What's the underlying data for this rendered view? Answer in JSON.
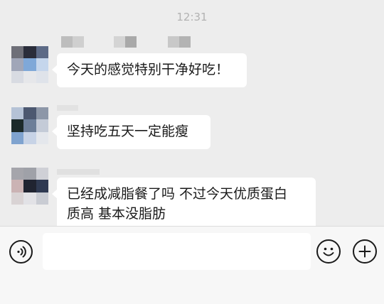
{
  "status": {
    "time": "12:31"
  },
  "messages": [
    {
      "text": "今天的感觉特别干净好吃！"
    },
    {
      "text": "坚持吃五天一定能瘦"
    },
    {
      "text_lines": [
        "已经成减脂餐了吗 不过今天优质蛋白",
        "质高 基本没脂肪"
      ]
    }
  ],
  "input": {
    "value": "",
    "placeholder": ""
  },
  "icons": {
    "voice": "voice-icon",
    "emoji": "emoji-icon",
    "more": "plus-icon"
  },
  "colors": {
    "background": "#ededed",
    "bubble": "#ffffff",
    "text": "#1a1a1a",
    "time": "#b2b2b2"
  }
}
